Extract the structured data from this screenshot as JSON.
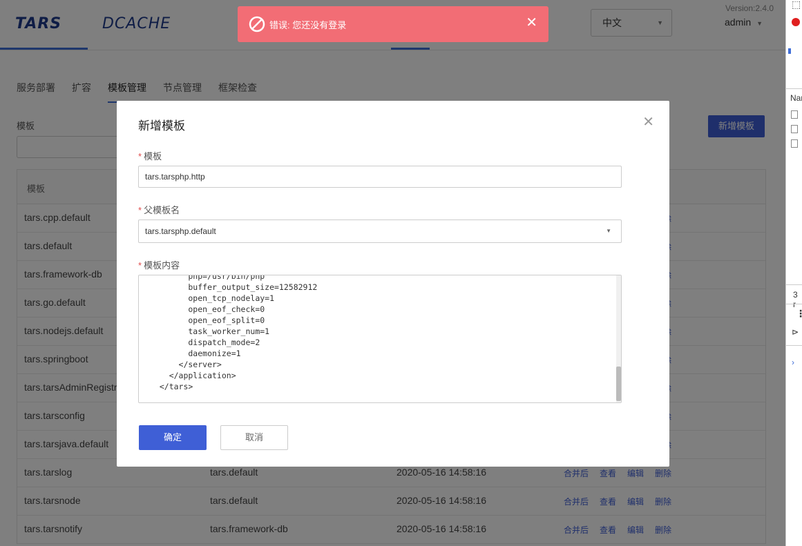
{
  "header": {
    "logo_tars": "TARS",
    "logo_dcache": "DCACHE",
    "language": "中文",
    "version": "Version:2.4.0",
    "user": "admin"
  },
  "tabs": [
    "服务部署",
    "扩容",
    "模板管理",
    "节点管理",
    "框架检查"
  ],
  "filter": {
    "label": "模板"
  },
  "add_button": "新增模板",
  "table": {
    "header_template": "模板",
    "actions": [
      "合并后",
      "查看",
      "编辑",
      "删除"
    ],
    "rows": [
      {
        "name": "tars.cpp.default",
        "parent": "",
        "time": ""
      },
      {
        "name": "tars.default",
        "parent": "",
        "time": ""
      },
      {
        "name": "tars.framework-db",
        "parent": "",
        "time": ""
      },
      {
        "name": "tars.go.default",
        "parent": "",
        "time": ""
      },
      {
        "name": "tars.nodejs.default",
        "parent": "",
        "time": ""
      },
      {
        "name": "tars.springboot",
        "parent": "",
        "time": ""
      },
      {
        "name": "tars.tarsAdminRegistr",
        "parent": "",
        "time": ""
      },
      {
        "name": "tars.tarsconfig",
        "parent": "",
        "time": ""
      },
      {
        "name": "tars.tarsjava.default",
        "parent": "",
        "time": ""
      },
      {
        "name": "tars.tarslog",
        "parent": "tars.default",
        "time": "2020-05-16 14:58:16"
      },
      {
        "name": "tars.tarsnode",
        "parent": "tars.default",
        "time": "2020-05-16 14:58:16"
      },
      {
        "name": "tars.tarsnotify",
        "parent": "tars.framework-db",
        "time": "2020-05-16 14:58:16"
      }
    ]
  },
  "modal": {
    "title": "新增模板",
    "template_label": "模板",
    "template_value": "tars.tarsphp.http",
    "parent_label": "父模板名",
    "parent_value": "tars.tarsphp.default",
    "content_label": "模板内容",
    "content_value": "        php=/usr/bin/php\n        buffer_output_size=12582912\n        open_tcp_nodelay=1\n        open_eof_check=0\n        open_eof_split=0\n        task_worker_num=1\n        dispatch_mode=2\n        daemonize=1\n      </server>\n    </application>\n  </tars>",
    "ok_label": "确定",
    "cancel_label": "取消"
  },
  "toast": {
    "message": "错误: 您还没有登录"
  },
  "devtools": {
    "name_col": "Nar",
    "count": "3 r"
  }
}
